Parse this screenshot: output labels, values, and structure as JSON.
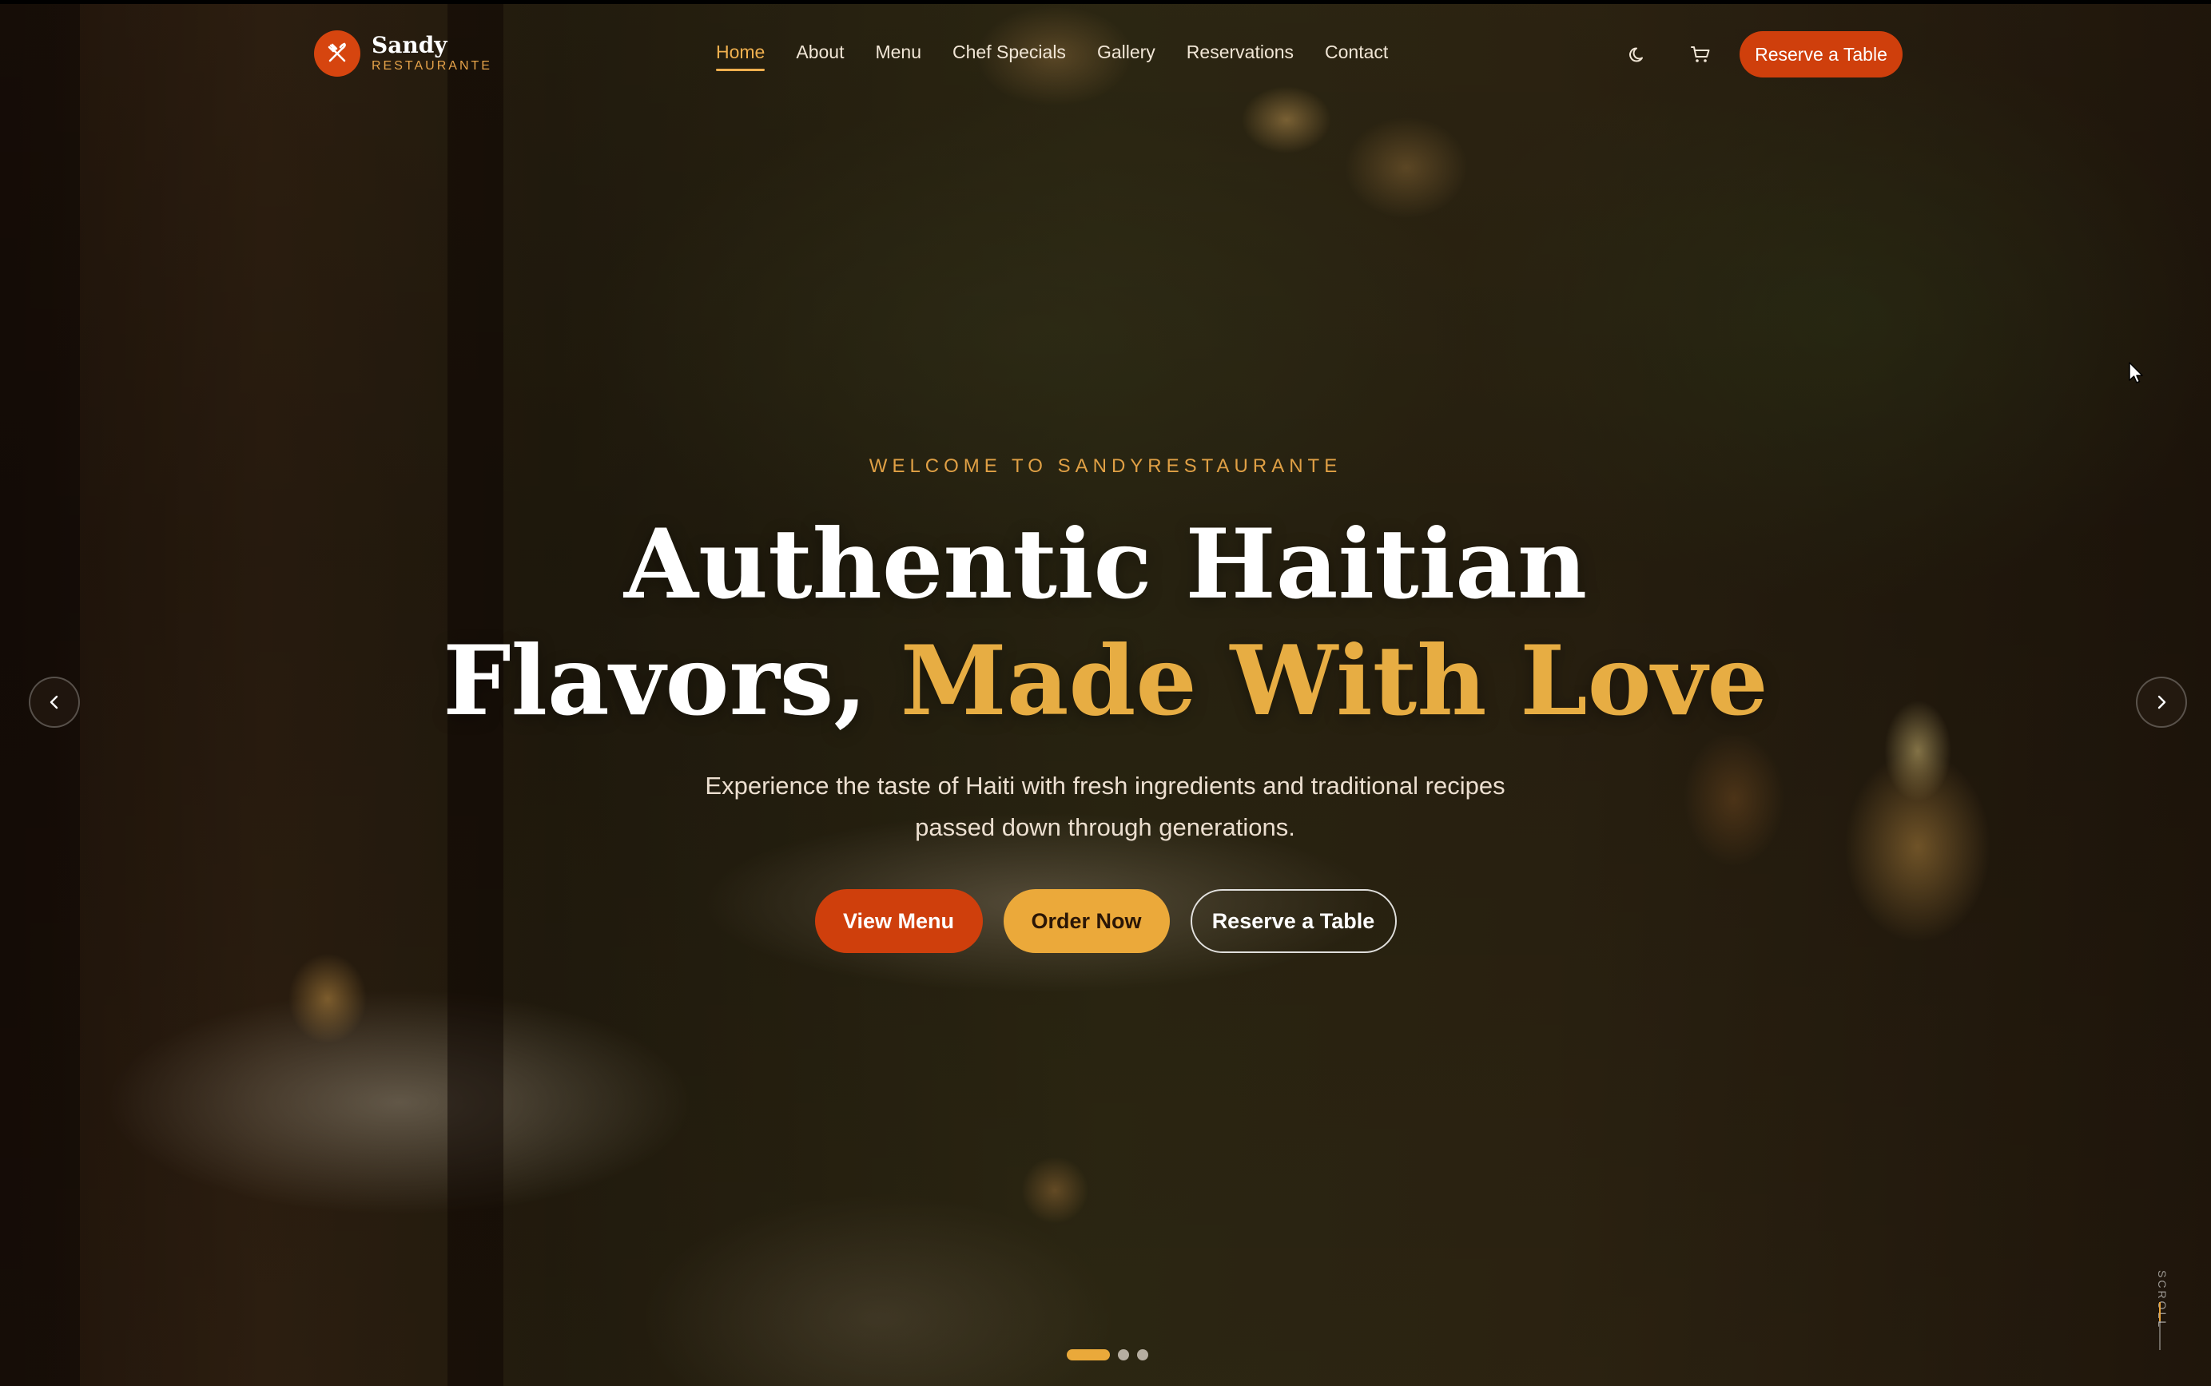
{
  "brand": {
    "name": "Sandy",
    "subtitle": "RESTAURANTE",
    "logo_icon": "utensils-icon"
  },
  "nav": {
    "items": [
      {
        "label": "Home",
        "active": true
      },
      {
        "label": "About",
        "active": false
      },
      {
        "label": "Menu",
        "active": false
      },
      {
        "label": "Chef Specials",
        "active": false
      },
      {
        "label": "Gallery",
        "active": false
      },
      {
        "label": "Reservations",
        "active": false
      },
      {
        "label": "Contact",
        "active": false
      }
    ],
    "theme_icon": "moon-icon",
    "cart_icon": "cart-icon",
    "reserve_label": "Reserve a Table"
  },
  "hero": {
    "eyebrow": "WELCOME TO SANDYRESTAURANTE",
    "headline_line1": "Authentic Haitian",
    "headline_line2_plain": "Flavors,",
    "headline_line2_accent": "Made With Love",
    "subtitle": "Experience the taste of Haiti with fresh ingredients and traditional recipes passed down through generations.",
    "cta": {
      "view_menu": "View Menu",
      "order_now": "Order Now",
      "reserve": "Reserve a Table"
    }
  },
  "carousel": {
    "prev_icon": "chevron-left-icon",
    "next_icon": "chevron-right-icon",
    "slide_count": 3,
    "active_slide": 1
  },
  "scroll_indicator": {
    "label": "SCROLL"
  },
  "colors": {
    "accent_orange": "#cf3f0c",
    "accent_gold": "#e7ad43",
    "text_light": "#f1e6d6"
  }
}
